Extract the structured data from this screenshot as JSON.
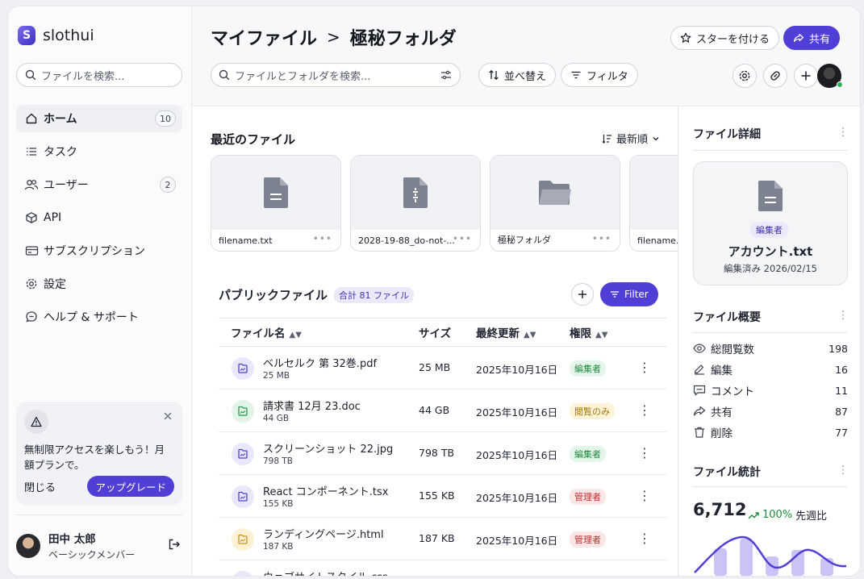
{
  "brand": {
    "name": "slothui",
    "logo_letter": "S"
  },
  "sidebar": {
    "search_placeholder": "ファイルを検索...",
    "items": [
      {
        "label": "ホーム",
        "count": "10",
        "icon": "home-icon"
      },
      {
        "label": "タスク",
        "icon": "list-icon"
      },
      {
        "label": "ユーザー",
        "count": "2",
        "icon": "users-icon"
      },
      {
        "label": "API",
        "icon": "cube-icon"
      },
      {
        "label": "サブスクリプション",
        "icon": "card-icon"
      },
      {
        "label": "設定",
        "icon": "gear-icon"
      },
      {
        "label": "ヘルプ & サポート",
        "icon": "chat-icon"
      }
    ],
    "promo": {
      "text": "無制限アクセスを楽しもう！月額プランで。",
      "dismiss": "閉じる",
      "upgrade": "アップグレード"
    },
    "user": {
      "name": "田中 太郎",
      "role": "ベーシックメンバー"
    }
  },
  "header": {
    "breadcrumb_root": "マイファイル",
    "breadcrumb_current": "極秘フォルダ",
    "star_label": "スターを付ける",
    "share_label": "共有",
    "search_placeholder": "ファイルとフォルダを検索...",
    "sort_label": "並べ替え",
    "filter_label": "フィルタ"
  },
  "recent": {
    "title": "最近のファイル",
    "sort": "最新順",
    "cards": [
      {
        "name": "filename.txt",
        "type": "document-icon"
      },
      {
        "name": "2028-19-88_do-not-...",
        "type": "zip-icon"
      },
      {
        "name": "極秘フォルダ",
        "type": "folder-icon"
      },
      {
        "name": "filename.t",
        "type": "document-icon"
      }
    ]
  },
  "public_files": {
    "title": "パブリックファイル",
    "total": "合計 81 ファイル",
    "filter": "Filter",
    "columns": {
      "name": "ファイル名",
      "size": "サイズ",
      "updated": "最終更新",
      "perm": "権限"
    },
    "rows": [
      {
        "name": "ベルセルク 第 32巻.pdf",
        "sub": "25 MB",
        "size": "25 MB",
        "date": "2025年10月16日",
        "perm": "編集者",
        "perm_type": "edit",
        "icon_color": "#e9e7fb",
        "icon_fg": "#4f3fd6"
      },
      {
        "name": "請求書 12月 23.doc",
        "sub": "44 GB",
        "size": "44 GB",
        "date": "2025年10月16日",
        "perm": "閲覧のみ",
        "perm_type": "view",
        "icon_color": "#e1f4e6",
        "icon_fg": "#2a9a4b"
      },
      {
        "name": "スクリーンショット 22.jpg",
        "sub": "798 TB",
        "size": "798 TB",
        "date": "2025年10月16日",
        "perm": "編集者",
        "perm_type": "edit",
        "icon_color": "#e9e7fb",
        "icon_fg": "#4f3fd6"
      },
      {
        "name": "React コンポーネント.tsx",
        "sub": "155 KB",
        "size": "155 KB",
        "date": "2025年10月16日",
        "perm": "管理者",
        "perm_type": "admin",
        "icon_color": "#e9e7fb",
        "icon_fg": "#4f3fd6"
      },
      {
        "name": "ランディングページ.html",
        "sub": "187 KB",
        "size": "187 KB",
        "date": "2025年10月16日",
        "perm": "管理者",
        "perm_type": "admin",
        "icon_color": "#fdf1d4",
        "icon_fg": "#c9921a"
      },
      {
        "name": "ウェブサイトスタイル.css",
        "sub": "",
        "size": "",
        "date": "",
        "perm": "",
        "perm_type": "edit",
        "icon_color": "#e9e7fb",
        "icon_fg": "#4f3fd6"
      }
    ]
  },
  "details": {
    "title": "ファイル詳細",
    "badge": "編集者",
    "file_name": "アカウント.txt",
    "edited": "編集済み 2026/02/15"
  },
  "overview": {
    "title": "ファイル概要",
    "stats": [
      {
        "label": "総閲覧数",
        "value": "198",
        "icon": "eye-icon"
      },
      {
        "label": "編集",
        "value": "16",
        "icon": "pencil-icon"
      },
      {
        "label": "コメント",
        "value": "11",
        "icon": "comment-icon"
      },
      {
        "label": "共有",
        "value": "87",
        "icon": "share-icon"
      },
      {
        "label": "削除",
        "value": "77",
        "icon": "trash-icon"
      }
    ]
  },
  "stats": {
    "title": "ファイル統計",
    "total": "6,712",
    "pct": "100%",
    "suffix": "先週比"
  },
  "colors": {
    "accent": "#4f3fd6",
    "edit": "#1f8a3e",
    "view": "#a8750c",
    "admin": "#c02f2f"
  }
}
